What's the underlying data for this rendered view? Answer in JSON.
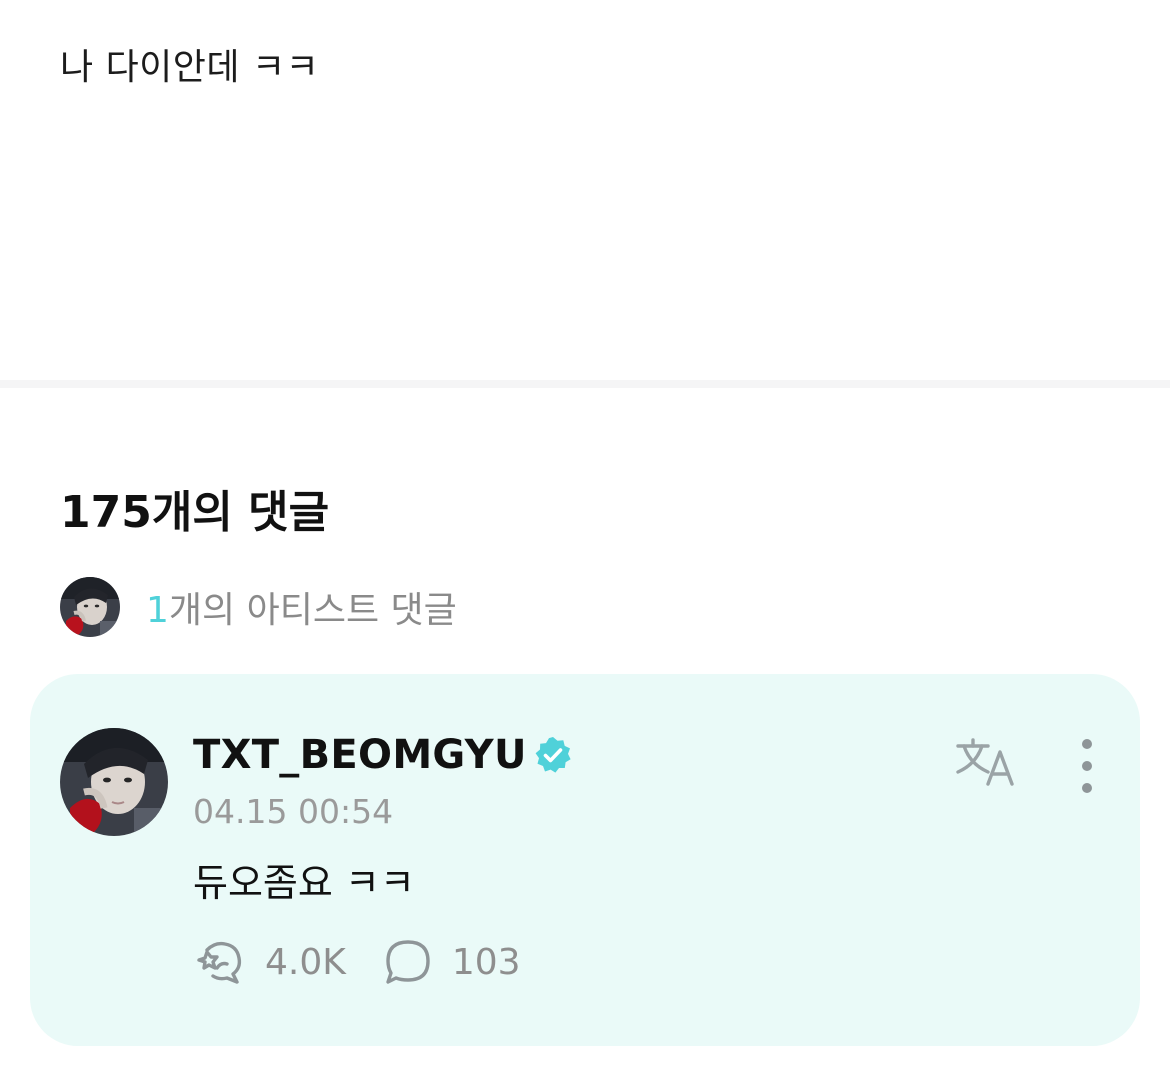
{
  "post": {
    "body": "나 다이안데 ㅋㅋ"
  },
  "comments": {
    "title": "175개의 댓글",
    "artist_summary": {
      "count": "1",
      "label": "개의 아티스트 댓글"
    },
    "items": [
      {
        "author": "TXT_BEOMGYU",
        "verified": true,
        "timestamp": "04.15 00:54",
        "text": "듀오좀요 ㅋㅋ",
        "likes": "4.0K",
        "replies": "103"
      }
    ]
  },
  "icons": {
    "verified": "verified-badge-icon",
    "translate": "translate-icon",
    "more": "more-vertical-icon",
    "like": "cheer-hand-icon",
    "reply": "speech-bubble-icon"
  },
  "colors": {
    "accent": "#4fd1d9",
    "card_background": "#eafaf8",
    "muted_text": "#8a8a8a"
  }
}
